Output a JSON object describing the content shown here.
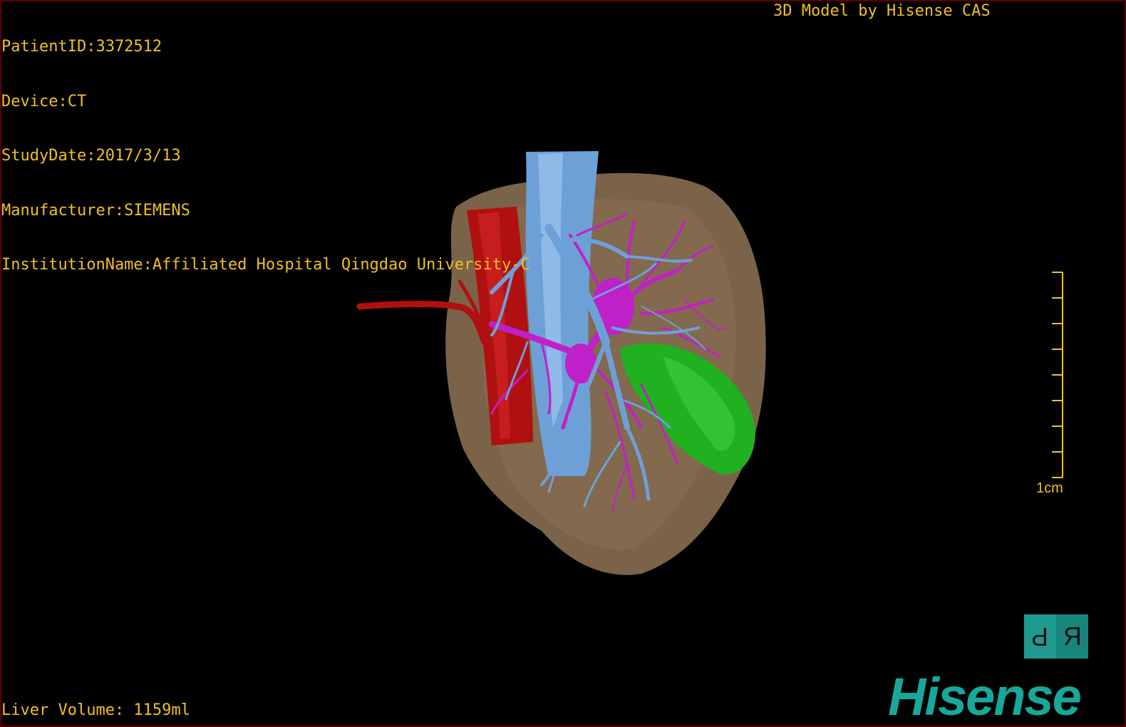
{
  "info": {
    "patient_id": "PatientID:3372512",
    "device": "Device:CT",
    "study_date": "StudyDate:2017/3/13",
    "manufacturer": "Manufacturer:SIEMENS",
    "institution": "InstitutionName:Affiliated Hospital Qingdao University-C"
  },
  "credit": "3D Model by Hisense CAS",
  "liver_volume": "Liver Volume: 1159ml",
  "scale_bar": {
    "label": "1cm"
  },
  "orientation": {
    "left_glyph": "P",
    "right_glyph": "R"
  },
  "brand": {
    "logo": "Hisense"
  },
  "colors": {
    "overlay_text": "#f0c020",
    "liver": "#7a6348",
    "artery": "#b01010",
    "vein": "#6ea0d8",
    "portal_vein": "#c020c8",
    "tumor": "#20b020",
    "brand": "#17a89a"
  }
}
